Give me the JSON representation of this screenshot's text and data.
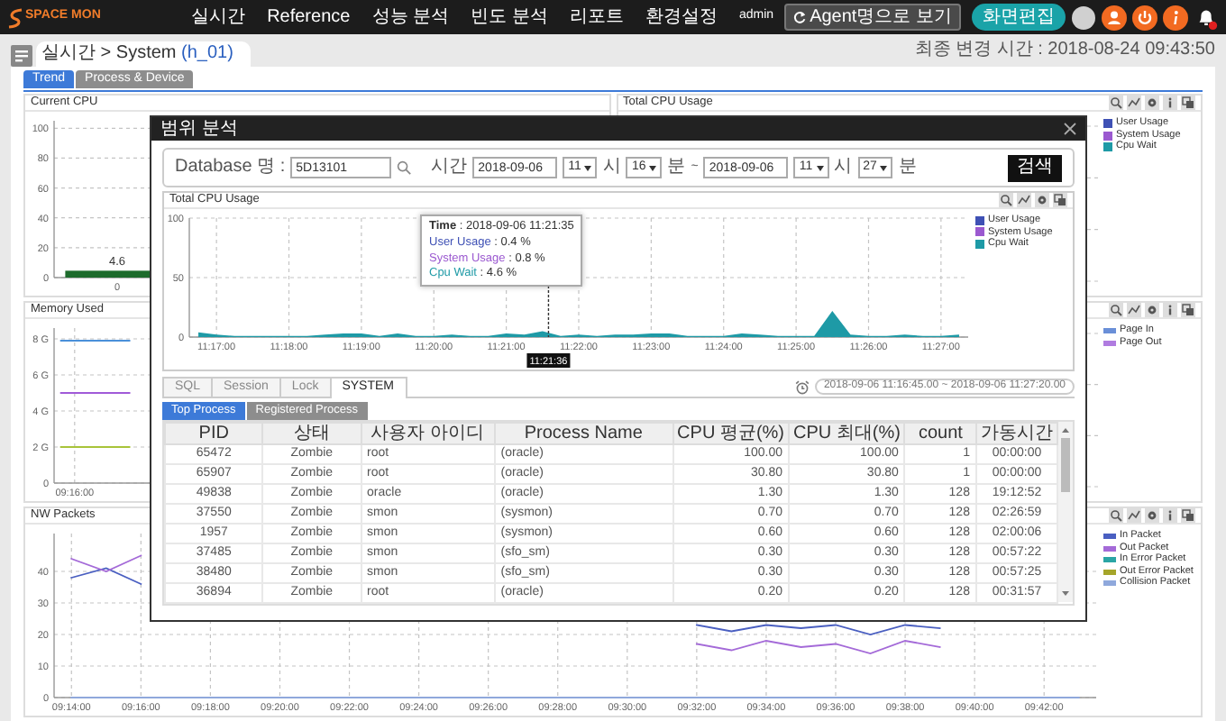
{
  "topbar": {
    "logo": "SPACE MON",
    "menu": [
      {
        "label": "실시간"
      },
      {
        "label": "Reference"
      },
      {
        "label": "성능 분석"
      },
      {
        "label": "빈도 분석"
      },
      {
        "label": "리포트"
      },
      {
        "label": "환경설정"
      }
    ],
    "user": "admin",
    "agent_button": "Agent명으로 보기",
    "edit_button": "화면편집"
  },
  "breadcrumb": {
    "path": "실시간 > System",
    "host": "(h_01)"
  },
  "last_changed": "최종 변경 시간 : 2018-08-24 09:43:50",
  "view_tabs": [
    {
      "label": "Trend",
      "selected": true
    },
    {
      "label": "Process & Device",
      "selected": false
    }
  ],
  "panels": [
    {
      "kind": "chart",
      "title": "Current CPU",
      "chart_data": {
        "type": "bar",
        "categories": [
          "0"
        ],
        "values": [
          4.6
        ],
        "ylim": [
          0,
          105
        ],
        "yticks": [
          0,
          20,
          40,
          60,
          80,
          100
        ],
        "grid": true,
        "data_labels": true
      }
    },
    {
      "kind": "area_drawing",
      "title": "Total CPU Usage",
      "toolbar": true,
      "legend": [
        {
          "name": "User Usage",
          "color": "#3f51b5"
        },
        {
          "name": "System Usage",
          "color": "#9b59d0"
        },
        {
          "name": "Cpu Wait",
          "color": "#1e9aa6"
        }
      ]
    },
    {
      "kind": "chart",
      "title": "Memory Used",
      "chart_data": {
        "type": "line",
        "categories": [
          null,
          "09:16:00",
          null,
          null,
          null,
          null,
          null,
          null,
          null,
          null,
          null,
          null,
          null,
          null,
          null,
          null,
          null,
          null,
          null,
          null,
          null,
          null,
          null,
          null,
          null,
          null,
          null,
          null,
          null,
          null,
          null,
          null,
          null,
          null,
          null,
          null,
          null,
          null,
          null,
          null
        ],
        "ylim": [
          0,
          8.6
        ],
        "grid": true,
        "yticks": [
          {
            "value": 0,
            "label": "0"
          },
          {
            "value": 2,
            "label": "2 G"
          },
          {
            "value": 4,
            "label": "4 G"
          },
          {
            "value": 6,
            "label": "6 G"
          },
          {
            "value": 8,
            "label": "8 G"
          }
        ],
        "series": [
          {
            "color": "#4a90d9",
            "values": [
              7.9,
              7.9,
              7.9,
              7.9,
              7.9,
              7.9,
              null,
              null,
              null,
              null,
              null,
              null,
              null,
              null,
              null,
              null,
              null,
              null,
              null,
              null,
              null,
              null,
              null,
              null,
              null,
              null,
              null,
              null,
              null,
              null,
              null,
              null,
              null,
              null,
              null,
              null,
              null,
              null,
              null,
              null
            ]
          },
          {
            "color": "#a05ad8",
            "values": [
              5,
              5,
              5,
              5,
              5,
              5,
              null,
              null,
              null,
              null,
              null,
              null,
              null,
              null,
              null,
              null,
              null,
              null,
              null,
              null,
              null,
              null,
              null,
              null,
              null,
              null,
              null,
              null,
              null,
              null,
              null,
              null,
              null,
              null,
              null,
              null,
              null,
              null,
              null,
              null
            ]
          },
          {
            "color": "#a8c43a",
            "values": [
              2,
              2,
              2,
              2,
              2,
              2,
              null,
              null,
              null,
              null,
              null,
              null,
              null,
              null,
              null,
              null,
              null,
              null,
              null,
              null,
              null,
              null,
              null,
              null,
              null,
              null,
              null,
              null,
              null,
              null,
              null,
              null,
              null,
              null,
              null,
              null,
              null,
              null,
              null,
              null
            ]
          }
        ]
      }
    },
    {
      "kind": "line_drawing",
      "toolbar": true,
      "legend": [
        {
          "name": "Page In",
          "color": "#6a8fd8"
        },
        {
          "name": "Page Out",
          "color": "#b07ce0"
        }
      ]
    },
    {
      "kind": "chart",
      "title": "NW Packets",
      "wide": true,
      "toolbar": true,
      "chart_data": {
        "type": "line",
        "legend": "right",
        "grid": true,
        "categories": [
          "09:14:00",
          null,
          "09:16:00",
          null,
          "09:18:00",
          null,
          "09:20:00",
          null,
          "09:22:00",
          null,
          "09:24:00",
          null,
          "09:26:00",
          null,
          "09:28:00",
          null,
          "09:30:00",
          null,
          "09:32:00",
          null,
          "09:34:00",
          null,
          "09:36:00",
          null,
          "09:38:00",
          null,
          "09:40:00",
          null,
          "09:42:00",
          null
        ],
        "ylim": [
          0,
          52
        ],
        "yticks": [
          0,
          10,
          20,
          30,
          40
        ],
        "series": [
          {
            "name": "In Packet",
            "color": "#4a5fc1",
            "values": [
              38,
              41,
              36,
              null,
              null,
              null,
              null,
              null,
              null,
              null,
              null,
              null,
              null,
              null,
              null,
              null,
              null,
              null,
              23,
              21,
              23,
              22,
              23,
              20,
              23,
              22,
              null,
              null,
              null,
              null
            ]
          },
          {
            "name": "Out Packet",
            "color": "#a46ad8",
            "values": [
              44,
              40,
              45,
              null,
              null,
              null,
              null,
              null,
              null,
              null,
              null,
              null,
              null,
              null,
              null,
              null,
              null,
              null,
              17,
              15,
              18,
              16,
              17,
              14,
              18,
              16,
              null,
              null,
              null,
              null
            ]
          },
          {
            "name": "In Error Packet",
            "color": "#2aa5a5",
            "values": [
              null,
              null,
              null,
              null,
              null,
              null,
              null,
              null,
              null,
              null,
              null,
              null,
              null,
              null,
              null,
              null,
              null,
              null,
              null,
              null,
              null,
              null,
              null,
              null,
              null,
              null,
              null,
              null,
              null,
              null
            ]
          },
          {
            "name": "Out Error Packet",
            "color": "#a5a52a",
            "values": [
              null,
              null,
              null,
              null,
              null,
              null,
              null,
              null,
              null,
              null,
              null,
              null,
              null,
              null,
              null,
              null,
              null,
              null,
              null,
              null,
              null,
              null,
              null,
              null,
              null,
              null,
              null,
              null,
              null,
              null
            ]
          },
          {
            "name": "Collision Packet",
            "color": "#8fa8dc",
            "values": [
              0,
              0,
              0,
              0,
              0,
              0,
              0,
              0,
              0,
              0,
              0,
              0,
              0,
              0,
              0,
              0,
              0,
              0,
              0,
              0,
              0,
              0,
              0,
              0,
              0,
              0,
              0,
              0,
              0,
              0
            ]
          }
        ]
      }
    }
  ],
  "range_dialog": {
    "title": "범위 분석",
    "db_label": "Database 명 :",
    "db_value": "5D13101",
    "time_label": "시간",
    "from": {
      "date": "2018-09-06",
      "hour": "11",
      "hour_unit": "시",
      "minute": "16",
      "minute_unit": "분"
    },
    "separator": "~",
    "to": {
      "date": "2018-09-06",
      "hour": "11",
      "hour_unit": "시",
      "minute": "27",
      "minute_unit": "분"
    },
    "search_button": "검색",
    "chart": {
      "title": "Total CPU Usage",
      "cursor_label": "11:21:36",
      "chart_data": {
        "type": "area",
        "legend": "right",
        "grid": true,
        "categories": [
          null,
          "11:17:00",
          null,
          null,
          null,
          "11:18:00",
          null,
          null,
          null,
          "11:19:00",
          null,
          null,
          null,
          "11:20:00",
          null,
          null,
          null,
          "11:21:00",
          null,
          null,
          null,
          "11:22:00",
          null,
          null,
          null,
          "11:23:00",
          null,
          null,
          null,
          "11:24:00",
          null,
          null,
          null,
          "11:25:00",
          null,
          null,
          null,
          "11:26:00",
          null,
          null,
          null,
          "11:27:00",
          null
        ],
        "ylim": [
          0,
          100
        ],
        "yticks": [
          0,
          50,
          100
        ],
        "series": [
          {
            "name": "User Usage",
            "color": "#3f51b5",
            "values": [
              null,
              null,
              null,
              null,
              null,
              null,
              null,
              null,
              null,
              null,
              null,
              null,
              null,
              null,
              null,
              null,
              null,
              null,
              null,
              null,
              null,
              null,
              null,
              null,
              null,
              null,
              null,
              null,
              null,
              null,
              null,
              null,
              null,
              null,
              null,
              null,
              null,
              null,
              null,
              null,
              null,
              null,
              null
            ]
          },
          {
            "name": "System Usage",
            "color": "#9b59d0",
            "values": [
              null,
              null,
              null,
              null,
              null,
              null,
              null,
              null,
              null,
              null,
              null,
              null,
              null,
              null,
              null,
              null,
              null,
              null,
              null,
              null,
              null,
              null,
              null,
              null,
              null,
              null,
              null,
              null,
              null,
              null,
              null,
              null,
              null,
              null,
              null,
              null,
              null,
              null,
              null,
              null,
              null,
              null,
              null
            ]
          },
          {
            "name": "Cpu Wait",
            "color": "#1e9aa6",
            "values": [
              4,
              2,
              1,
              1,
              1,
              1,
              1,
              2,
              3,
              3,
              1,
              3,
              1,
              1,
              2,
              1,
              1,
              3,
              2,
              5,
              1,
              2,
              1,
              2,
              2,
              3,
              3,
              1,
              1,
              1,
              3,
              2,
              1,
              1,
              1,
              22,
              2,
              1,
              1,
              2,
              1,
              1,
              2
            ]
          }
        ]
      },
      "tooltip": [
        {
          "kind": "header",
          "text": "**Time** : 2018-09-06 11:21:35"
        },
        {
          "kind": "series",
          "label": "User Usage",
          "value": ": 0.4 %",
          "color": "#3f51b5"
        },
        {
          "kind": "series",
          "label": "System Usage",
          "value": ": 0.8 %",
          "color": "#9b59d0"
        },
        {
          "kind": "series",
          "label": "Cpu Wait",
          "value": ": 4.6 %",
          "color": "#1e9aa6"
        }
      ]
    },
    "tabs": [
      {
        "label": "SQL",
        "selected": false
      },
      {
        "label": "Session",
        "selected": false
      },
      {
        "label": "Lock",
        "selected": false
      },
      {
        "label": "SYSTEM",
        "selected": true
      }
    ],
    "range_text": "2018-09-06 11:16:45.00 ~ 2018-09-06 11:27:20.00",
    "sub_tabs": [
      {
        "label": "Top Process",
        "selected": true
      },
      {
        "label": "Registered Process",
        "selected": false
      }
    ],
    "table": {
      "columns": [
        "PID",
        "상태",
        "사용자 아이디",
        "Process Name",
        "CPU 평균(%)",
        "CPU 최대(%)",
        "count",
        "가동시간"
      ],
      "rows": [
        [
          "65472",
          "Zombie",
          "root",
          "(oracle)",
          "100.00",
          "100.00",
          "1",
          "00:00:00"
        ],
        [
          "65907",
          "Zombie",
          "root",
          "(oracle)",
          "30.80",
          "30.80",
          "1",
          "00:00:00"
        ],
        [
          "49838",
          "Zombie",
          "oracle",
          "(oracle)",
          "1.30",
          "1.30",
          "128",
          "19:12:52"
        ],
        [
          "37550",
          "Zombie",
          "smon",
          "(sysmon)",
          "0.70",
          "0.70",
          "128",
          "02:26:59"
        ],
        [
          "1957",
          "Zombie",
          "smon",
          "(sysmon)",
          "0.60",
          "0.60",
          "128",
          "02:00:06"
        ],
        [
          "37485",
          "Zombie",
          "smon",
          "(sfo_sm)",
          "0.30",
          "0.30",
          "128",
          "00:57:22"
        ],
        [
          "38480",
          "Zombie",
          "smon",
          "(sfo_sm)",
          "0.30",
          "0.30",
          "128",
          "00:57:25"
        ],
        [
          "36894",
          "Zombie",
          "root",
          "(oracle)",
          "0.20",
          "0.20",
          "128",
          "00:31:57"
        ]
      ]
    }
  }
}
